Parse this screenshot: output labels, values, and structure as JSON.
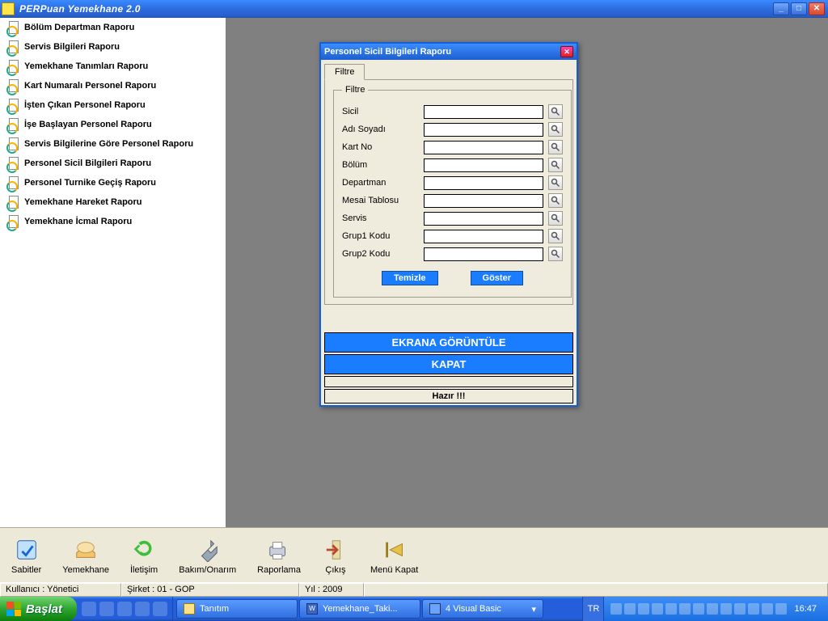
{
  "app": {
    "title": "PERPuan Yemekhane 2.0"
  },
  "sidebar": {
    "items": [
      {
        "label": "Bölüm Departman Raporu"
      },
      {
        "label": "Servis Bilgileri Raporu"
      },
      {
        "label": "Yemekhane Tanımları Raporu"
      },
      {
        "label": "Kart Numaralı Personel Raporu"
      },
      {
        "label": "İşten Çıkan Personel Raporu"
      },
      {
        "label": "İşe Başlayan Personel Raporu"
      },
      {
        "label": "Servis Bilgilerine Göre Personel Raporu"
      },
      {
        "label": "Personel Sicil Bilgileri Raporu"
      },
      {
        "label": "Personel Turnike Geçiş Raporu"
      },
      {
        "label": "Yemekhane Hareket Raporu"
      },
      {
        "label": "Yemekhane İcmal Raporu"
      }
    ]
  },
  "dialog": {
    "title": "Personel Sicil Bilgileri Raporu",
    "tab": "Filtre",
    "fieldset": "Filtre",
    "fields": {
      "sicil": {
        "label": "Sicil",
        "value": ""
      },
      "adsoyad": {
        "label": "Adı Soyadı",
        "value": ""
      },
      "kartno": {
        "label": "Kart No",
        "value": ""
      },
      "bolum": {
        "label": "Bölüm",
        "value": ""
      },
      "departman": {
        "label": "Departman",
        "value": ""
      },
      "mesai": {
        "label": "Mesai Tablosu",
        "value": ""
      },
      "servis": {
        "label": "Servis",
        "value": ""
      },
      "grup1": {
        "label": "Grup1 Kodu",
        "value": ""
      },
      "grup2": {
        "label": "Grup2 Kodu",
        "value": ""
      }
    },
    "buttons": {
      "clear": "Temizle",
      "show": "Göster",
      "screen": "EKRANA GÖRÜNTÜLE",
      "close": "KAPAT",
      "status": "Hazır !!!"
    }
  },
  "toolbar": {
    "items": [
      {
        "id": "sabitler",
        "label": "Sabitler"
      },
      {
        "id": "yemekhane",
        "label": "Yemekhane"
      },
      {
        "id": "iletisim",
        "label": "İletişim"
      },
      {
        "id": "bakim",
        "label": "Bakım/Onarım"
      },
      {
        "id": "raporlama",
        "label": "Raporlama"
      },
      {
        "id": "cikis",
        "label": "Çıkış"
      },
      {
        "id": "menukapat",
        "label": "Menü Kapat"
      }
    ]
  },
  "statusbar": {
    "user": "Kullanıcı : Yönetici",
    "sirket": "Şirket : 01 - GOP",
    "yil": "Yıl : 2009"
  },
  "taskbar": {
    "start": "Başlat",
    "tasks": [
      {
        "label": "Tanıtım"
      },
      {
        "label": "Yemekhane_Taki..."
      },
      {
        "label": "4 Visual Basic"
      }
    ],
    "lang": "TR",
    "clock": "16:47"
  }
}
